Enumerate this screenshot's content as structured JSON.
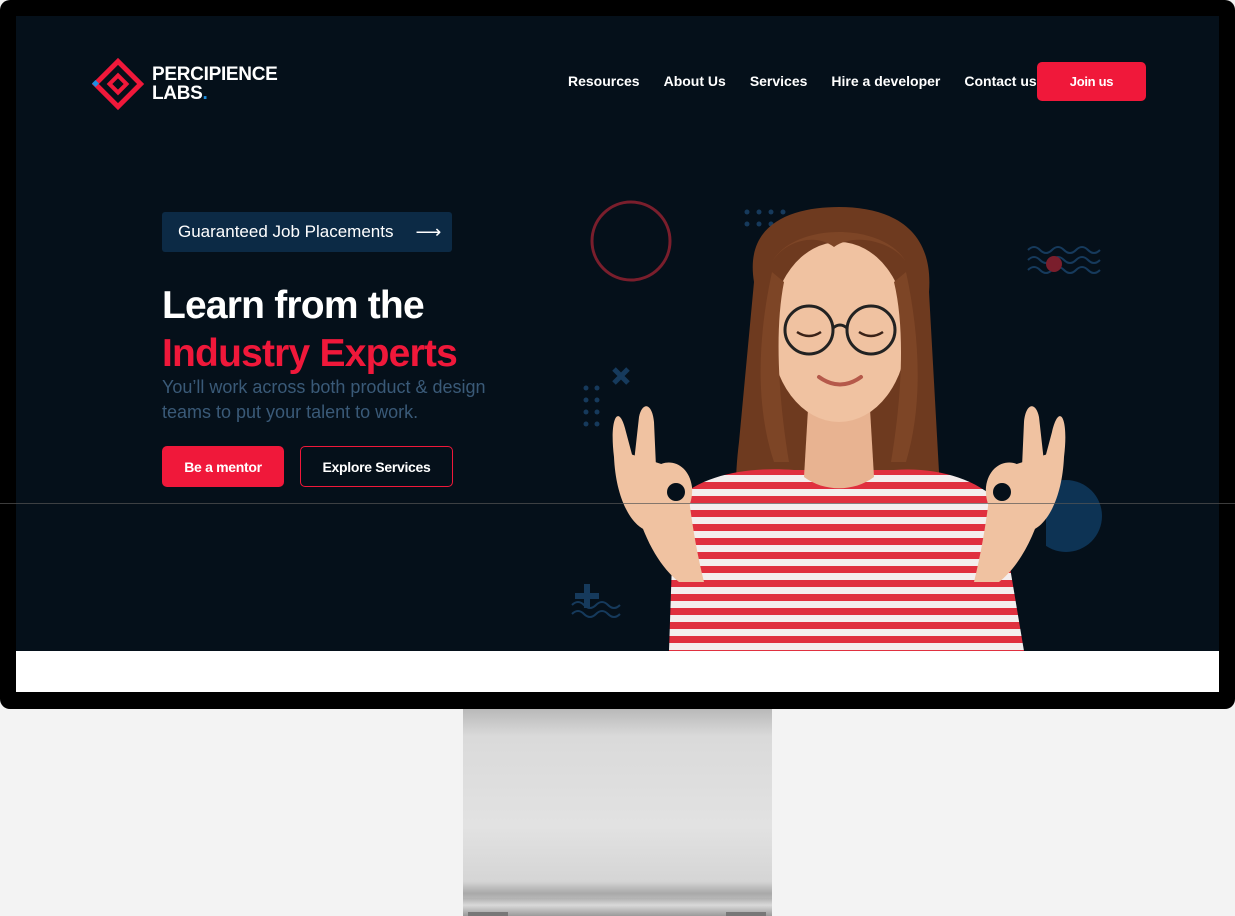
{
  "brand": {
    "line1": "PERCIPIENCE",
    "line2": "LABS",
    "dot": ".",
    "colors": {
      "primary": "#f0183a",
      "accent": "#1e8fe0",
      "background": "#05101a",
      "pill": "#0c2a45"
    }
  },
  "nav": {
    "items": [
      {
        "label": "Resources"
      },
      {
        "label": "About Us"
      },
      {
        "label": "Services"
      },
      {
        "label": "Hire a developer"
      },
      {
        "label": "Contact us"
      }
    ],
    "cta": "Join us"
  },
  "hero": {
    "badge": "Guaranteed Job Placements",
    "badge_icon": "arrow-right-icon",
    "heading_line1": "Learn from the",
    "heading_line2": "Industry Experts",
    "subtext": "You’ll work across both product & design teams to put your talent to work.",
    "primary_button": "Be a mentor",
    "secondary_button": "Explore Services",
    "image": "smiling-woman-ok-gesture"
  }
}
